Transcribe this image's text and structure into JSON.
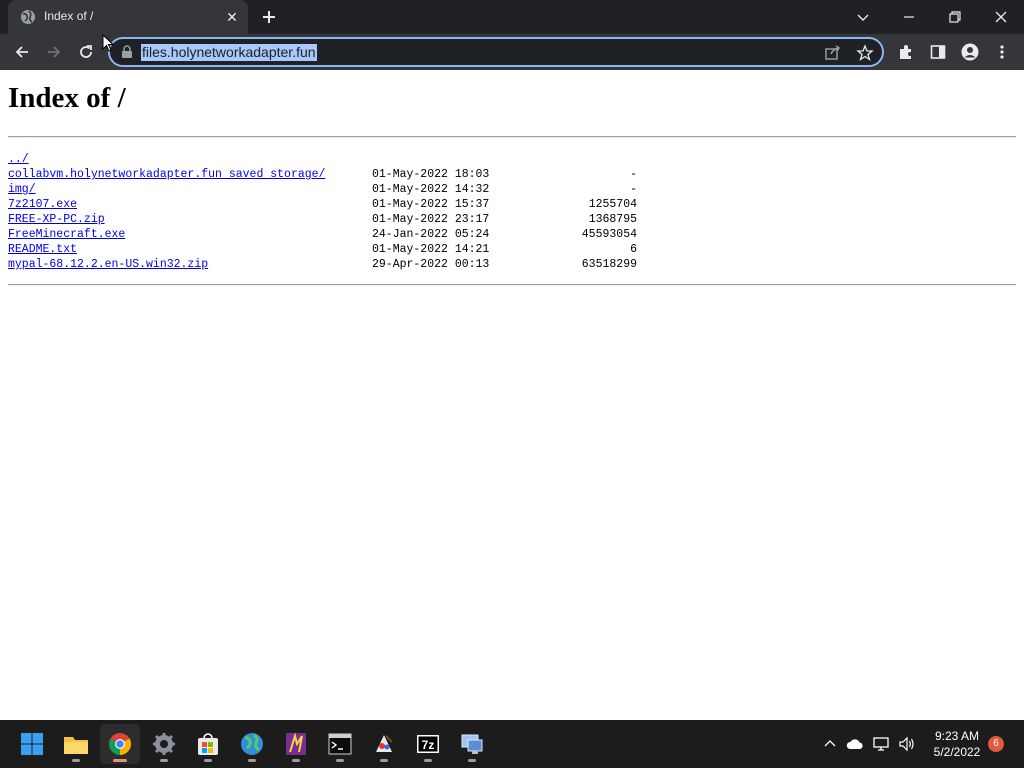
{
  "browser": {
    "tab": {
      "title": "Index of /",
      "favicon": "globe-icon"
    },
    "address_bar": {
      "url": "files.holynetworkadapter.fun"
    },
    "colors": {
      "tabstrip": "#202124",
      "toolbar": "#35363a",
      "accent": "#8ab4f8"
    }
  },
  "page": {
    "heading": "Index of /",
    "parent_link": "../",
    "entries": [
      {
        "name": "collabvm.holynetworkadapter.fun saved storage/",
        "date": "01-May-2022 18:03",
        "size": "-"
      },
      {
        "name": "img/",
        "date": "01-May-2022 14:32",
        "size": "-"
      },
      {
        "name": "7z2107.exe",
        "date": "01-May-2022 15:37",
        "size": "1255704"
      },
      {
        "name": "FREE-XP-PC.zip",
        "date": "01-May-2022 23:17",
        "size": "1368795"
      },
      {
        "name": "FreeMinecraft.exe",
        "date": "24-Jan-2022 05:24",
        "size": "45593054"
      },
      {
        "name": "README.txt",
        "date": "01-May-2022 14:21",
        "size": "6"
      },
      {
        "name": "mypal-68.12.2.en-US.win32.zip",
        "date": "29-Apr-2022 00:13",
        "size": "63518299"
      }
    ],
    "colors": {
      "link": "#0000ee"
    }
  },
  "taskbar": {
    "apps": [
      "start-icon",
      "file-explorer-icon",
      "chrome-icon",
      "settings-icon",
      "microsoft-store-icon",
      "globe-browser-icon",
      "winamp-icon",
      "terminal-icon",
      "paint-icon",
      "7zip-icon",
      "remote-desktop-icon"
    ],
    "clock": {
      "time": "9:23 AM",
      "date": "5/2/2022"
    },
    "notification_count": "6"
  }
}
